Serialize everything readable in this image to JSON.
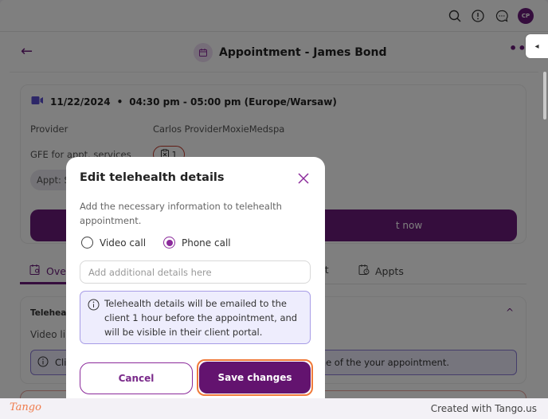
{
  "topbar": {
    "icons": [
      "search-icon",
      "alert-icon",
      "chat-icon"
    ],
    "avatar_initials": "CP"
  },
  "header": {
    "back_icon": "←",
    "title": "Appointment - James Bond",
    "more_icon": "•••",
    "side_toggle_icon": "◂"
  },
  "appointment": {
    "date": "11/22/2024",
    "separator": "•",
    "time": "04:30 pm - 05:00 pm (Europe/Warsaw)",
    "provider_label": "Provider",
    "provider_value": "Carlos ProviderMoxieMedspa",
    "gfe_label": "GFE for appt. services",
    "gfe_count": "1",
    "appt_status_pill": "Appt: S",
    "join_button_label": "Join video call now",
    "join_visible_fragment": "t now"
  },
  "tabs": [
    {
      "label": "Ove",
      "icon": "calendar-user-icon",
      "active": true
    },
    {
      "label": "art",
      "icon": "",
      "active": false
    },
    {
      "label": "Appts",
      "icon": "calendar-clock-icon",
      "active": false
    }
  ],
  "telehealth_card": {
    "heading": "Telehealt",
    "video_link_label": "Video lin",
    "info_prefix": "Cli",
    "info_suffix": "time of the your appointment."
  },
  "modal": {
    "title": "Edit telehealth details",
    "description": "Add the necessary information to telehealth appointment.",
    "radio_options": [
      {
        "label": "Video call",
        "selected": false
      },
      {
        "label": "Phone call",
        "selected": true
      }
    ],
    "details_input": {
      "value": "",
      "placeholder": "Add additional details here"
    },
    "info_text": "Telehealth details will be emailed to the client 1 hour before the appointment, and will be visible in their client portal.",
    "cancel_label": "Cancel",
    "save_label": "Save changes"
  },
  "footer": {
    "logo": "Tango",
    "created_with": "Created with Tango.us"
  },
  "colors": {
    "brand_purple": "#63136f",
    "accent_purple": "#8b2a9b",
    "highlight_orange": "#f07a3a",
    "info_bg": "#eeedfd",
    "info_border": "#a79ce6"
  }
}
